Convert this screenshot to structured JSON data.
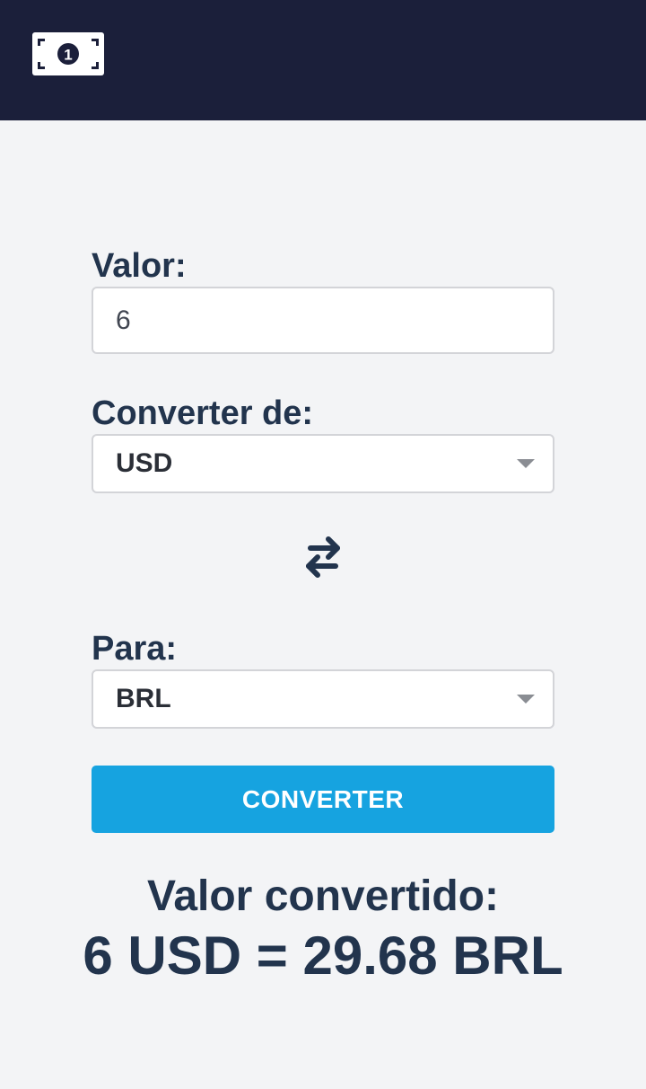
{
  "header": {
    "logo_icon": "banknote-icon",
    "logo_text": "1",
    "background": "#1b1f3a"
  },
  "form": {
    "amount_label": "Valor:",
    "amount_value": "6",
    "from_label": "Converter de:",
    "from_value": "USD",
    "swap_icon": "swap-arrows-icon",
    "to_label": "Para:",
    "to_value": "BRL",
    "convert_button": "CONVERTER",
    "button_color": "#16a3e0"
  },
  "result": {
    "title": "Valor convertido:",
    "value": "6 USD = 29.68 BRL"
  }
}
